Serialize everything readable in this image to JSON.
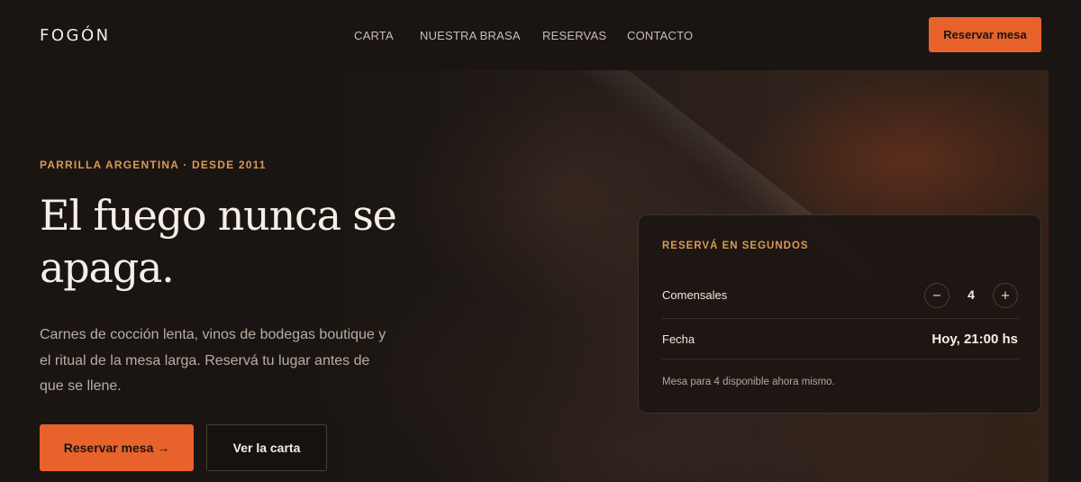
{
  "header": {
    "logo": "FOGÓN",
    "nav": [
      "CARTA",
      "NUESTRA BRASA",
      "RESERVAS",
      "CONTACTO"
    ],
    "cta_label": "Reservar mesa"
  },
  "hero": {
    "eyebrow": "PARRILLA ARGENTINA · DESDE 2011",
    "title": "El fuego nunca se apaga.",
    "description": "Carnes de cocción lenta, vinos de bodegas boutique y el ritual de la mesa larga. Reservá tu lugar antes de que se llene.",
    "primary_button": "Reservar mesa →",
    "secondary_button": "Ver la carta"
  },
  "booking": {
    "title": "RESERVÁ EN SEGUNDOS",
    "guests_label": "Comensales",
    "guests_value": "4",
    "minus_symbol": "−",
    "plus_symbol": "+",
    "date_label": "Fecha",
    "date_value": "Hoy, 21:00 hs",
    "availability": "Mesa para 4 disponible ahora mismo."
  },
  "colors": {
    "accent": "#e8622c",
    "eyebrow": "#d89a56",
    "background": "#1a1512"
  }
}
